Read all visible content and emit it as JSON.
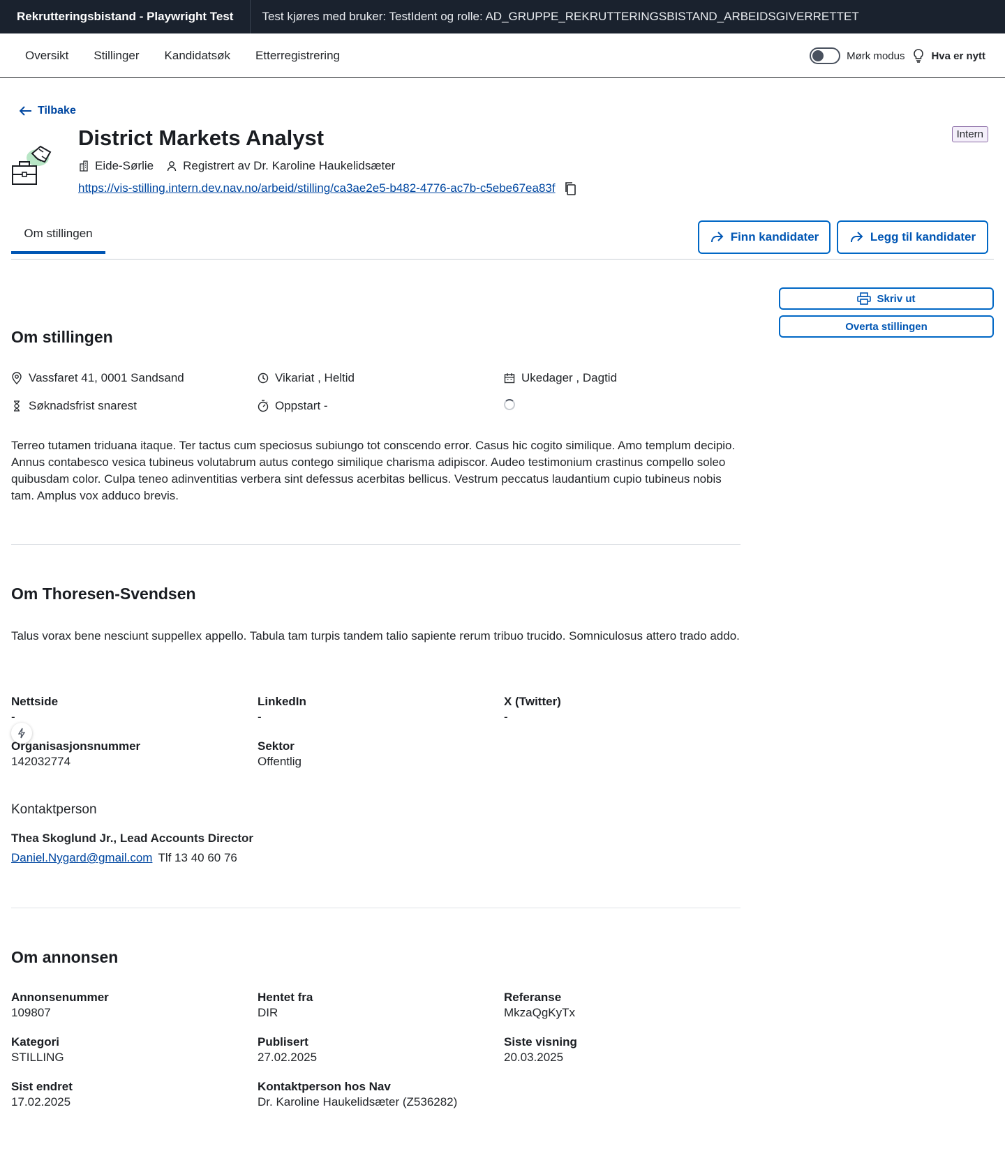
{
  "topbar": {
    "brand": "Rekrutteringsbistand - Playwright Test",
    "role_text": "Test kjøres med bruker: TestIdent og rolle: AD_GRUPPE_REKRUTTERINGSBISTAND_ARBEIDSGIVERRETTET"
  },
  "nav": {
    "items": [
      "Oversikt",
      "Stillinger",
      "Kandidatsøk",
      "Etterregistrering"
    ],
    "dark_mode_label": "Mørk modus",
    "whats_new": "Hva er nytt"
  },
  "header": {
    "back": "Tilbake",
    "title": "District Markets Analyst",
    "employer": "Eide-Sørlie",
    "registered_by": "Registrert av Dr. Karoline Haukelidsæter",
    "url": "https://vis-stilling.intern.dev.nav.no/arbeid/stilling/ca3ae2e5-b482-4776-ac7b-c5ebe67ea83f",
    "tag": "Intern"
  },
  "tabs": {
    "active": "Om stillingen",
    "find_candidates": "Finn kandidater",
    "add_candidates": "Legg til kandidater"
  },
  "side": {
    "print": "Skriv ut",
    "take_over": "Overta stillingen"
  },
  "about_position": {
    "heading": "Om stillingen",
    "address": "Vassfaret 41, 0001 Sandsand",
    "employment": "Vikariat , Heltid",
    "schedule": "Ukedager , Dagtid",
    "deadline": "Søknadsfrist snarest",
    "start": "Oppstart -",
    "description": "Terreo tutamen triduana itaque. Ter tactus cum speciosus subiungo tot conscendo error. Casus hic cogito similique. Amo templum decipio. Annus contabesco vesica tubineus volutabrum autus contego similique charisma adipiscor. Audeo testimonium crastinus compello soleo quibusdam color. Culpa teneo adinventitias verbera sint defessus acerbitas bellicus. Vestrum peccatus laudantium cupio tubineus nobis tam. Amplus vox adduco brevis."
  },
  "about_employer": {
    "heading": "Om Thoresen-Svendsen",
    "description": "Talus vorax bene nesciunt suppellex appello. Tabula tam turpis tandem talio sapiente rerum tribuo trucido. Somniculosus attero trado addo.",
    "fields": [
      {
        "label": "Nettside",
        "value": "-"
      },
      {
        "label": "LinkedIn",
        "value": "-"
      },
      {
        "label": "X (Twitter)",
        "value": "-"
      },
      {
        "label": "Organisasjonsnummer",
        "value": "142032774"
      },
      {
        "label": "Sektor",
        "value": "Offentlig"
      }
    ],
    "contact_heading": "Kontaktperson",
    "contact_name": "Thea Skoglund Jr., Lead Accounts Director",
    "contact_email": "Daniel.Nygard@gmail.com",
    "contact_phone": "Tlf 13 40 60 76"
  },
  "about_ad": {
    "heading": "Om annonsen",
    "fields": [
      {
        "label": "Annonsenummer",
        "value": "109807"
      },
      {
        "label": "Hentet fra",
        "value": "DIR"
      },
      {
        "label": "Referanse",
        "value": "MkzaQgKyTx"
      },
      {
        "label": "Kategori",
        "value": "STILLING"
      },
      {
        "label": "Publisert",
        "value": "27.02.2025"
      },
      {
        "label": "Siste visning",
        "value": "20.03.2025"
      },
      {
        "label": "Sist endret",
        "value": "17.02.2025"
      },
      {
        "label": "Kontaktperson hos Nav",
        "value": "Dr. Karoline Haukelidsæter (Z536282)"
      }
    ]
  }
}
